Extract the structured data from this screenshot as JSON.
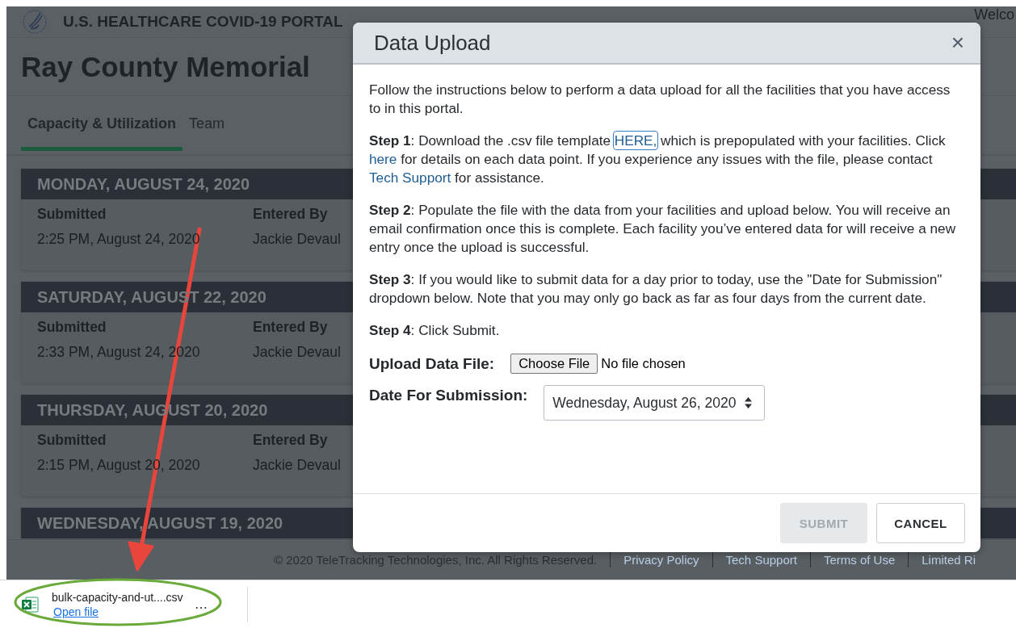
{
  "header": {
    "portal_title": "U.S. HEALTHCARE COVID-19 PORTAL",
    "welcome": "Welco"
  },
  "page_title": "Ray County Memorial",
  "tabs": [
    {
      "label": "Capacity & Utilization",
      "selected": true
    },
    {
      "label": "Team",
      "selected": false
    }
  ],
  "entries": [
    {
      "date": "MONDAY, AUGUST 24, 2020",
      "fields": [
        {
          "label": "Submitted",
          "value": "2:25 PM, August 24, 2020"
        },
        {
          "label": "Entered By",
          "value": "Jackie Devaul"
        }
      ]
    },
    {
      "date": "SATURDAY, AUGUST 22, 2020",
      "fields": [
        {
          "label": "Submitted",
          "value": "2:33 PM, August 24, 2020"
        },
        {
          "label": "Entered By",
          "value": "Jackie Devaul"
        }
      ]
    },
    {
      "date": "THURSDAY, AUGUST 20, 2020",
      "fields": [
        {
          "label": "Submitted",
          "value": "2:15 PM, August 20, 2020"
        },
        {
          "label": "Entered By",
          "value": "Jackie Devaul"
        }
      ]
    },
    {
      "date": "WEDNESDAY, AUGUST 19, 2020"
    }
  ],
  "footer": {
    "copyright": "© 2020 TeleTracking Technologies, Inc. All Rights Reserved.",
    "links": [
      "Privacy Policy",
      "Tech Support",
      "Terms of Use",
      "Limited Ri"
    ]
  },
  "modal": {
    "title": "Data Upload",
    "close": "×",
    "paragraphs": [
      [
        {
          "kind": "text",
          "text": "Follow the instructions below to perform a data upload for all the facilities that you have access to in this portal."
        }
      ],
      [
        {
          "kind": "text",
          "text": "**Step 1**: Download the .csv file template "
        },
        {
          "kind": "link",
          "text": "HERE,",
          "focused": true
        },
        {
          "kind": "text",
          "text": " which is prepopulated with your facilities. Click "
        },
        {
          "kind": "link",
          "text": "here",
          "focused": false
        },
        {
          "kind": "text",
          "text": " for details on each data point. If you experience any issues with the file, please contact "
        },
        {
          "kind": "link",
          "text": "Tech Support",
          "focused": false
        },
        {
          "kind": "text",
          "text": " for assistance."
        }
      ],
      [
        {
          "kind": "text",
          "text": "**Step 2**: Populate the file with the data from your facilities and upload below. You will receive an email confirmation once this is complete. Each facility you’ve entered data for will receive a new entry once the upload is successful."
        }
      ],
      [
        {
          "kind": "text",
          "text": "**Step 3**: If you would like to submit data for a day prior to today, use the \"Date for Submission\" dropdown below. Note that you may only go back as far as four days from the current date."
        }
      ],
      [
        {
          "kind": "text",
          "text": "**Step 4**: Click Submit."
        }
      ]
    ],
    "upload": {
      "label": "Upload Data File:",
      "button": "Choose File",
      "status": "No file chosen"
    },
    "date": {
      "label": "Date For Submission:",
      "value": "Wednesday, August 26, 2020"
    },
    "buttons": [
      {
        "label": "SUBMIT",
        "disabled": true
      },
      {
        "label": "CANCEL",
        "disabled": false
      }
    ]
  },
  "download": {
    "filename": "bulk-capacity-and-ut....csv",
    "action": "Open file",
    "more": "⋯"
  }
}
